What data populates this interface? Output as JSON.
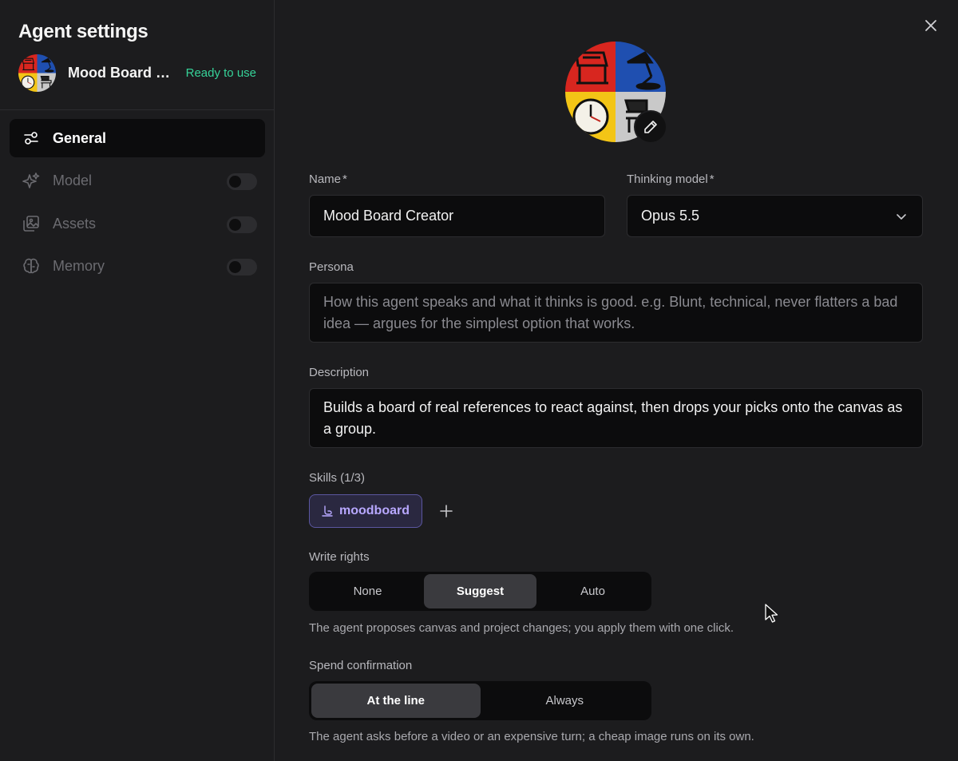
{
  "sidebar": {
    "title": "Agent settings",
    "agent_name": "Mood Board Creator",
    "status": "Ready to use",
    "status_color": "#36d399",
    "nav": [
      {
        "label": "General",
        "icon": "sliders-icon",
        "active": true
      },
      {
        "label": "Model",
        "icon": "sparkles-icon",
        "toggle": false
      },
      {
        "label": "Assets",
        "icon": "images-icon",
        "toggle": false
      },
      {
        "label": "Memory",
        "icon": "brain-icon",
        "toggle": false
      }
    ]
  },
  "main": {
    "name": {
      "label": "Name",
      "required": "*",
      "value": "Mood Board Creator"
    },
    "thinking_model": {
      "label": "Thinking model",
      "required": "*",
      "value": "Opus 5.5"
    },
    "persona": {
      "label": "Persona",
      "placeholder": "How this agent speaks and what it thinks is good. e.g. Blunt, technical, never flatters a bad idea — argues for the simplest option that works."
    },
    "description": {
      "label": "Description",
      "value": "Builds a board of real references to react against, then drops your picks onto the canvas as a group."
    },
    "skills": {
      "label": "Skills (1/3)",
      "items": [
        "moodboard"
      ],
      "accent": "#b8a8ff"
    },
    "write_rights": {
      "label": "Write rights",
      "options": [
        "None",
        "Suggest",
        "Auto"
      ],
      "selected": "Suggest",
      "hint": "The agent proposes canvas and project changes; you apply them with one click."
    },
    "spend_confirmation": {
      "label": "Spend confirmation",
      "options": [
        "At the line",
        "Always"
      ],
      "selected": "At the line",
      "hint": "The agent asks before a video or an expensive turn; a cheap image runs on its own."
    }
  }
}
